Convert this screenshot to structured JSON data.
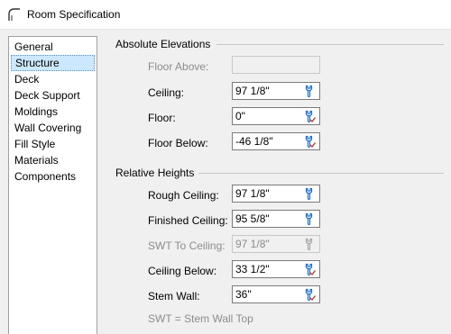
{
  "window": {
    "title": "Room Specification"
  },
  "nav": {
    "items": [
      {
        "label": "General"
      },
      {
        "label": "Structure",
        "selected": true
      },
      {
        "label": "Deck"
      },
      {
        "label": "Deck Support"
      },
      {
        "label": "Moldings"
      },
      {
        "label": "Wall Covering"
      },
      {
        "label": "Fill Style"
      },
      {
        "label": "Materials"
      },
      {
        "label": "Components"
      }
    ]
  },
  "absolute": {
    "title": "Absolute Elevations",
    "floor_above": {
      "label": "Floor Above:",
      "value": "",
      "enabled": false
    },
    "ceiling": {
      "label": "Ceiling:",
      "value": "97 1/8\"",
      "icon": "wrench-icon"
    },
    "floor": {
      "label": "Floor:",
      "value": "0\"",
      "icon": "wrench-check-icon"
    },
    "floor_below": {
      "label": "Floor Below:",
      "value": "-46 1/8\"",
      "icon": "wrench-check-icon"
    }
  },
  "relative": {
    "title": "Relative Heights",
    "rough_ceiling": {
      "label": "Rough Ceiling:",
      "value": "97 1/8\"",
      "icon": "wrench-icon"
    },
    "finished_ceiling": {
      "label": "Finished Ceiling:",
      "value": "95 5/8\"",
      "icon": "wrench-icon"
    },
    "swt_to_ceiling": {
      "label": "SWT To Ceiling:",
      "value": "97 1/8\"",
      "icon": "wrench-icon",
      "enabled": false
    },
    "ceiling_below": {
      "label": "Ceiling Below:",
      "value": "33 1/2\"",
      "icon": "wrench-check-icon"
    },
    "stem_wall": {
      "label": "Stem Wall:",
      "value": "36\"",
      "icon": "wrench-check-icon"
    },
    "note": "SWT = Stem Wall Top"
  },
  "colors": {
    "accent": "#1e6fd0",
    "check": "#c0392b",
    "selection": "#cce8ff"
  }
}
